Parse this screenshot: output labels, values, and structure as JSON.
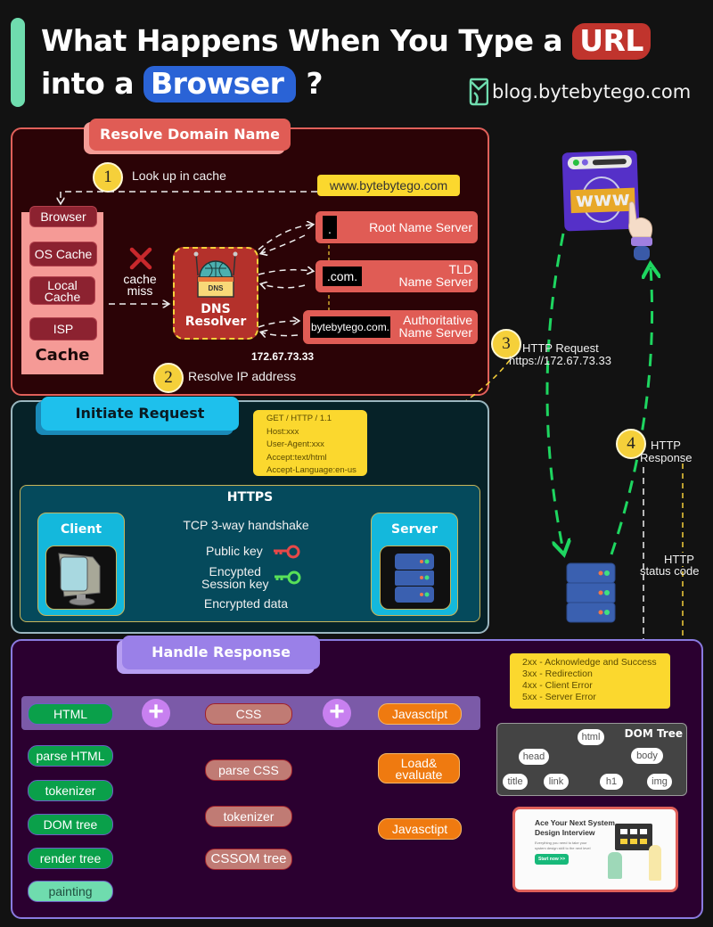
{
  "header": {
    "title_line1_prefix": "What Happens When You Type a",
    "title_line1_highlight": "URL",
    "title_line2_prefix": "into a",
    "title_line2_highlight": "Browser",
    "title_line2_suffix": "?",
    "brand": "blog.bytebytego.com",
    "colors": {
      "accent_green": "#6fdcae",
      "url_red": "#c0342d",
      "browser_blue": "#2a63d6"
    }
  },
  "resolve_domain": {
    "tab": "Resolve Domain Name",
    "step1": {
      "num": "1",
      "label": "Look up in cache"
    },
    "url": "www.bytebytego.com",
    "cache": {
      "items": [
        "Browser",
        "OS Cache",
        "Local Cache",
        "ISP"
      ],
      "title": "Cache"
    },
    "cache_miss": "cache miss",
    "resolver": {
      "icon_label": "DNS",
      "label_line1": "DNS",
      "label_line2": "Resolver"
    },
    "name_servers": [
      {
        "chip": ".",
        "label": "Root Name Server"
      },
      {
        "chip": ".com.",
        "label_line1": "TLD",
        "label_line2": "Name Server"
      },
      {
        "chip": "bytebytego.com.",
        "label_line1": "Authoritative",
        "label_line2": "Name Server"
      }
    ],
    "ip": "172.67.73.33",
    "step2": {
      "num": "2",
      "label": "Resolve IP address"
    }
  },
  "flow_right": {
    "step3": {
      "num": "3",
      "label_line1": "HTTP Request",
      "label_line2": "https://172.67.73.33"
    },
    "step4": {
      "num": "4",
      "label_line1": "HTTP",
      "label_line2": "Response"
    },
    "status_code_label_line1": "HTTP",
    "status_code_label_line2": "status code",
    "browser_icon": "www",
    "server_icon": "server-stack"
  },
  "initiate_request": {
    "tab": "Initiate Request",
    "request_lines": [
      "GET / HTTP / 1.1",
      "Host:xxx",
      "User-Agent:xxx",
      "Accept:text/html",
      "Accept-Language:en-us"
    ],
    "https": {
      "title": "HTTPS",
      "client": "Client",
      "server": "Server",
      "steps": [
        "TCP 3-way handshake",
        "Public key",
        "Encypted Session key",
        "Encrypted data"
      ],
      "step3_line1": "Encypted",
      "step3_line2": "Session key"
    }
  },
  "handle_response": {
    "tab": "Handle Response",
    "inputs": [
      "HTML",
      "CSS",
      "Javasctipt"
    ],
    "html_pipeline": [
      "parse HTML",
      "tokenizer",
      "DOM tree",
      "render tree",
      "painting"
    ],
    "css_pipeline": [
      "parse CSS",
      "tokenizer",
      "CSSOM tree"
    ],
    "js_pipeline": {
      "load_line1": "Load&",
      "load_line2": "evaluate",
      "js": "Javasctipt"
    },
    "status_codes": [
      "2xx - Acknowledge and Success",
      "3xx - Redirection",
      "4xx - Client Error",
      "5xx - Server Error"
    ],
    "dom_tree": {
      "title": "DOM Tree",
      "root": "html",
      "children": [
        "head",
        "body"
      ],
      "leaves": [
        "title",
        "link",
        "h1",
        "img"
      ]
    },
    "ad": {
      "headline_line1": "Ace Your Next System",
      "headline_line2": "Design Interview",
      "subtitle": "Everything you need to take your system design skill to the next level",
      "cta": "Start now >>"
    }
  }
}
